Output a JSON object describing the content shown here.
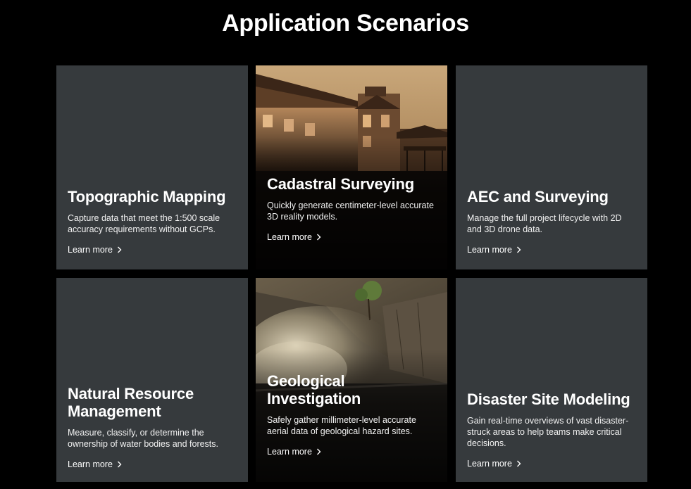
{
  "section": {
    "title": "Application Scenarios"
  },
  "cards": [
    {
      "title": "Topographic Mapping",
      "description": "Capture data that meet the 1:500 scale accuracy requirements without GCPs.",
      "link": "Learn more"
    },
    {
      "title": "Cadastral Surveying",
      "description": "Quickly generate centimeter-level accurate 3D reality models.",
      "link": "Learn more",
      "image": "house-photo"
    },
    {
      "title": "AEC and Surveying",
      "description": "Manage the full project lifecycle with 2D and 3D drone data.",
      "link": "Learn more"
    },
    {
      "title": "Natural Resource Management",
      "description": "Measure, classify, or determine the ownership of water bodies and forests.",
      "link": "Learn more"
    },
    {
      "title": "Geological Investigation",
      "description": "Safely gather millimeter-level accurate aerial data of geological hazard sites.",
      "link": "Learn more",
      "image": "cliff-dust-photo"
    },
    {
      "title": "Disaster Site Modeling",
      "description": "Gain real-time overviews of vast disaster-struck areas to help teams make critical decisions.",
      "link": "Learn more"
    }
  ],
  "icons": {
    "link_arrow": "chevron-right-icon"
  },
  "colors": {
    "background": "#000000",
    "card": "#363a3d",
    "text": "#ffffff"
  }
}
